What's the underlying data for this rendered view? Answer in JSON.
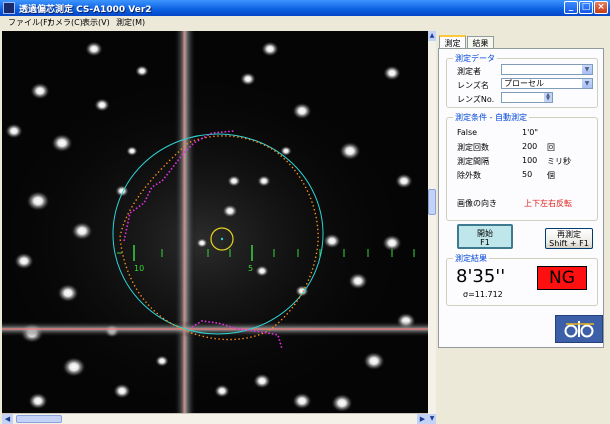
{
  "window": {
    "title": "透過偏芯測定 CS-A1000 Ver2",
    "controls": [
      "_",
      "□",
      "×"
    ]
  },
  "menu": [
    {
      "label": "ファイル(F)"
    },
    {
      "label": "カメラ(C)"
    },
    {
      "label": "表示(V)"
    },
    {
      "label": "測定(M)"
    }
  ],
  "image": {
    "scale_left": "10",
    "scale_right": "5"
  },
  "tabs": [
    {
      "label": "測定",
      "active": true
    },
    {
      "label": "結果",
      "active": false
    }
  ],
  "measurement_data": {
    "title": "測定データ",
    "operator_label": "測定者",
    "operator_value": "",
    "lens_label": "レンズ名",
    "lens_value": "プローセル",
    "lens_no_label": "レンズNo.",
    "lens_no_value": ""
  },
  "conditions": {
    "title": "測定条件 - 自動測定",
    "rows": [
      {
        "label": "False",
        "value": "1'0\"",
        "unit": ""
      },
      {
        "label": "測定回数",
        "value": "200",
        "unit": "回"
      },
      {
        "label": "測定間隔",
        "value": "100",
        "unit": "ミリ秒"
      },
      {
        "label": "除外数",
        "value": "50",
        "unit": "個"
      }
    ],
    "orientation_label": "画像の向き",
    "orientation_value": "上下左右反転"
  },
  "buttons": {
    "start_label": "開始",
    "start_key": "F1",
    "remeasure_label": "再測定",
    "remeasure_key": "Shift + F1"
  },
  "result": {
    "title": "測定結果",
    "value": "8'35''",
    "sigma": "σ=11.712",
    "status": "NG"
  },
  "colors": {
    "accent": "#0046d5",
    "ng": "#ff1010",
    "orientation": "#e0201b",
    "fit_circle": "#2fd3d3",
    "trace_orange": "#ff8c1a",
    "trace_magenta": "#e030e0"
  },
  "icons": {
    "logo": "company-logo-icon",
    "scroll_up": "arrow-up-icon",
    "scroll_down": "arrow-down-icon"
  }
}
